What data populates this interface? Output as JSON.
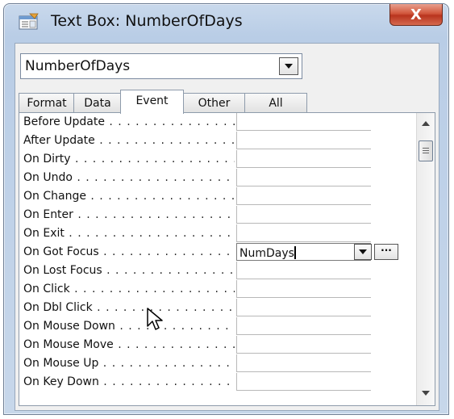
{
  "window": {
    "title": "Text Box: NumberOfDays",
    "close_label": "X"
  },
  "selector": {
    "value": "NumberOfDays"
  },
  "tabs": [
    {
      "label": "Format",
      "active": false
    },
    {
      "label": "Data",
      "active": false
    },
    {
      "label": "Event",
      "active": true
    },
    {
      "label": "Other",
      "active": false
    },
    {
      "label": "All",
      "active": false
    }
  ],
  "properties": [
    {
      "label": "Before Update",
      "value": ""
    },
    {
      "label": "After Update",
      "value": ""
    },
    {
      "label": "On Dirty",
      "value": ""
    },
    {
      "label": "On Undo",
      "value": ""
    },
    {
      "label": "On Change",
      "value": ""
    },
    {
      "label": "On Enter",
      "value": ""
    },
    {
      "label": "On Exit",
      "value": ""
    },
    {
      "label": "On Got Focus",
      "value": "NumDays",
      "focused": true
    },
    {
      "label": "On Lost Focus",
      "value": ""
    },
    {
      "label": "On Click",
      "value": ""
    },
    {
      "label": "On Dbl Click",
      "value": ""
    },
    {
      "label": "On Mouse Down",
      "value": ""
    },
    {
      "label": "On Mouse Move",
      "value": ""
    },
    {
      "label": "On Mouse Up",
      "value": ""
    },
    {
      "label": "On Key Down",
      "value": ""
    }
  ],
  "builder_label": "···",
  "icons": {
    "window": "property-sheet-icon",
    "dropdown": "chevron-down-icon",
    "cursor": "mouse-pointer-icon"
  },
  "colors": {
    "title_gradient": "#c9d9ec",
    "close_button": "#d2573c",
    "panel_bg": "#f0f0f0"
  }
}
